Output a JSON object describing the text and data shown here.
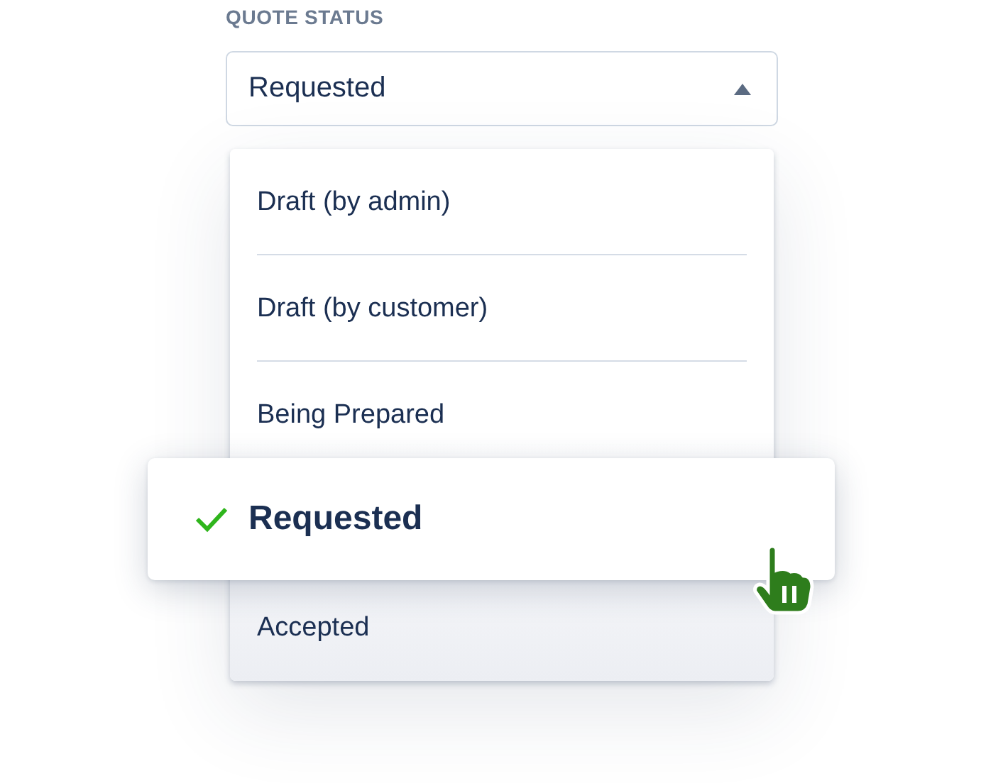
{
  "field": {
    "label": "QUOTE STATUS",
    "value": "Requested",
    "expanded": true
  },
  "options": [
    {
      "label": "Draft (by admin)",
      "selected": false
    },
    {
      "label": "Draft (by customer)",
      "selected": false
    },
    {
      "label": "Being Prepared",
      "selected": false
    },
    {
      "label": "Requested",
      "selected": true
    },
    {
      "label": "Accepted",
      "selected": false
    }
  ]
}
